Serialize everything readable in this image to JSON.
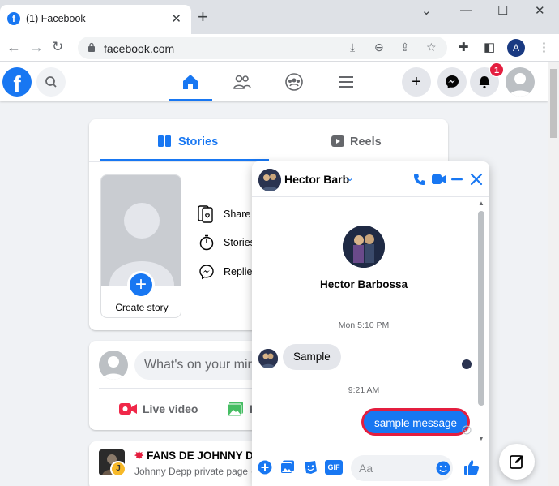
{
  "browser": {
    "tab_title": "(1) Facebook",
    "url": "facebook.com",
    "profile_initial": "A"
  },
  "facebook": {
    "notification_count": "1"
  },
  "stories": {
    "tab_stories": "Stories",
    "tab_reels": "Reels",
    "create_story": "Create story",
    "items": [
      "Share e",
      "Stories",
      "Replies"
    ]
  },
  "composer": {
    "placeholder": "What's on your mind",
    "live_video": "Live video",
    "photo_partial": "P"
  },
  "feed": {
    "post_title": "FANS DE JOHNNY DE",
    "post_subtitle": "Johnny Depp private page ·"
  },
  "chat": {
    "header_name": "Hector Barb",
    "profile_name": "Hector Barbossa",
    "timestamp_1": "Mon 5:10 PM",
    "incoming_message": "Sample",
    "timestamp_2": "9:21 AM",
    "outgoing_message": "sample message",
    "input_placeholder": "Aa",
    "gif_label": "GIF"
  },
  "colors": {
    "accent": "#1877f2",
    "badge": "#e41e3f",
    "highlight_outline": "#e41e3f"
  }
}
